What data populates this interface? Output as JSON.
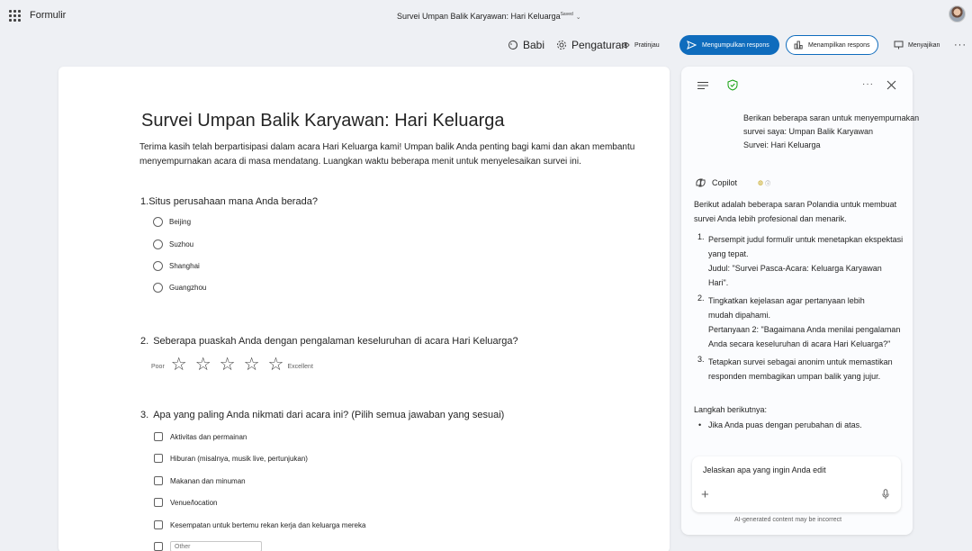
{
  "app": {
    "name": "Formulir"
  },
  "document": {
    "title": "Survei Umpan Balik Karyawan: Hari Keluarga",
    "saved_status": "Saved"
  },
  "toolbar": {
    "babi": "Babi",
    "pengaturan": "Pengaturan",
    "pratinjau": "Pratinjau",
    "collect": "Mengumpulkan respons",
    "show": "Menampilkan respons",
    "sajikan": "Menyajikan",
    "more": "···"
  },
  "form": {
    "title": "Survei Umpan Balik Karyawan: Hari Keluarga",
    "description_line1": "Terima kasih telah berpartisipasi dalam acara Hari Keluarga kami! Umpan balik Anda penting bagi kami dan akan membantu",
    "description_line2": "menyempurnakan acara di masa mendatang. Luangkan waktu beberapa menit untuk menyelesaikan survei ini.",
    "q1": {
      "num": "1.",
      "text": "Situs perusahaan mana Anda berada?",
      "options": [
        "Beijing",
        "Suzhou",
        "Shanghai",
        "Guangzhou"
      ]
    },
    "q2": {
      "num": "2.",
      "text": "Seberapa puaskah Anda dengan pengalaman keseluruhan di acara Hari Keluarga?",
      "low_label": "Poor",
      "high_label": "Excellent",
      "star": "☆"
    },
    "q3": {
      "num": "3.",
      "text": "Apa yang paling Anda nikmati dari acara ini? (Pilih semua jawaban yang sesuai)",
      "options": [
        "Aktivitas dan permainan",
        "Hiburan (misalnya, musik live, pertunjukan)",
        "Makanan dan minuman",
        "Venue/location",
        "Kesempatan untuk bertemu rekan kerja dan keluarga mereka"
      ],
      "other_placeholder": "Other"
    }
  },
  "copilot": {
    "user_message": [
      "Berikan beberapa saran untuk menyempurnakan",
      "survei saya: Umpan Balik Karyawan",
      "Survei: Hari Keluarga"
    ],
    "name": "Copilot",
    "intro": [
      "Berikut adalah beberapa saran Polandia untuk membuat",
      "survei Anda lebih profesional dan menarik."
    ],
    "suggestions": [
      {
        "num": "1.",
        "lines": [
          "Persempit judul formulir untuk menetapkan ekspektasi",
          "yang tepat.",
          "Judul: \"Survei Pasca-Acara: Keluarga Karyawan",
          "Hari\"."
        ]
      },
      {
        "num": "2.",
        "lines": [
          "Tingkatkan kejelasan agar pertanyaan lebih",
          "mudah dipahami.",
          "Pertanyaan 2: \"Bagaimana Anda menilai pengalaman",
          "Anda secara keseluruhan di acara Hari Keluarga?\""
        ]
      },
      {
        "num": "3.",
        "lines": [
          "Tetapkan survei sebagai anonim untuk memastikan",
          "responden membagikan umpan balik yang jujur."
        ]
      }
    ],
    "next_steps_title": "Langkah berikutnya:",
    "next_steps_item": "Jika Anda puas dengan perubahan di atas.",
    "input_placeholder": "Jelaskan apa yang ingin Anda edit",
    "disclaimer": "AI-generated content may be incorrect"
  },
  "colors": {
    "accent": "#0f6cbd",
    "shield": "#13a10e"
  }
}
